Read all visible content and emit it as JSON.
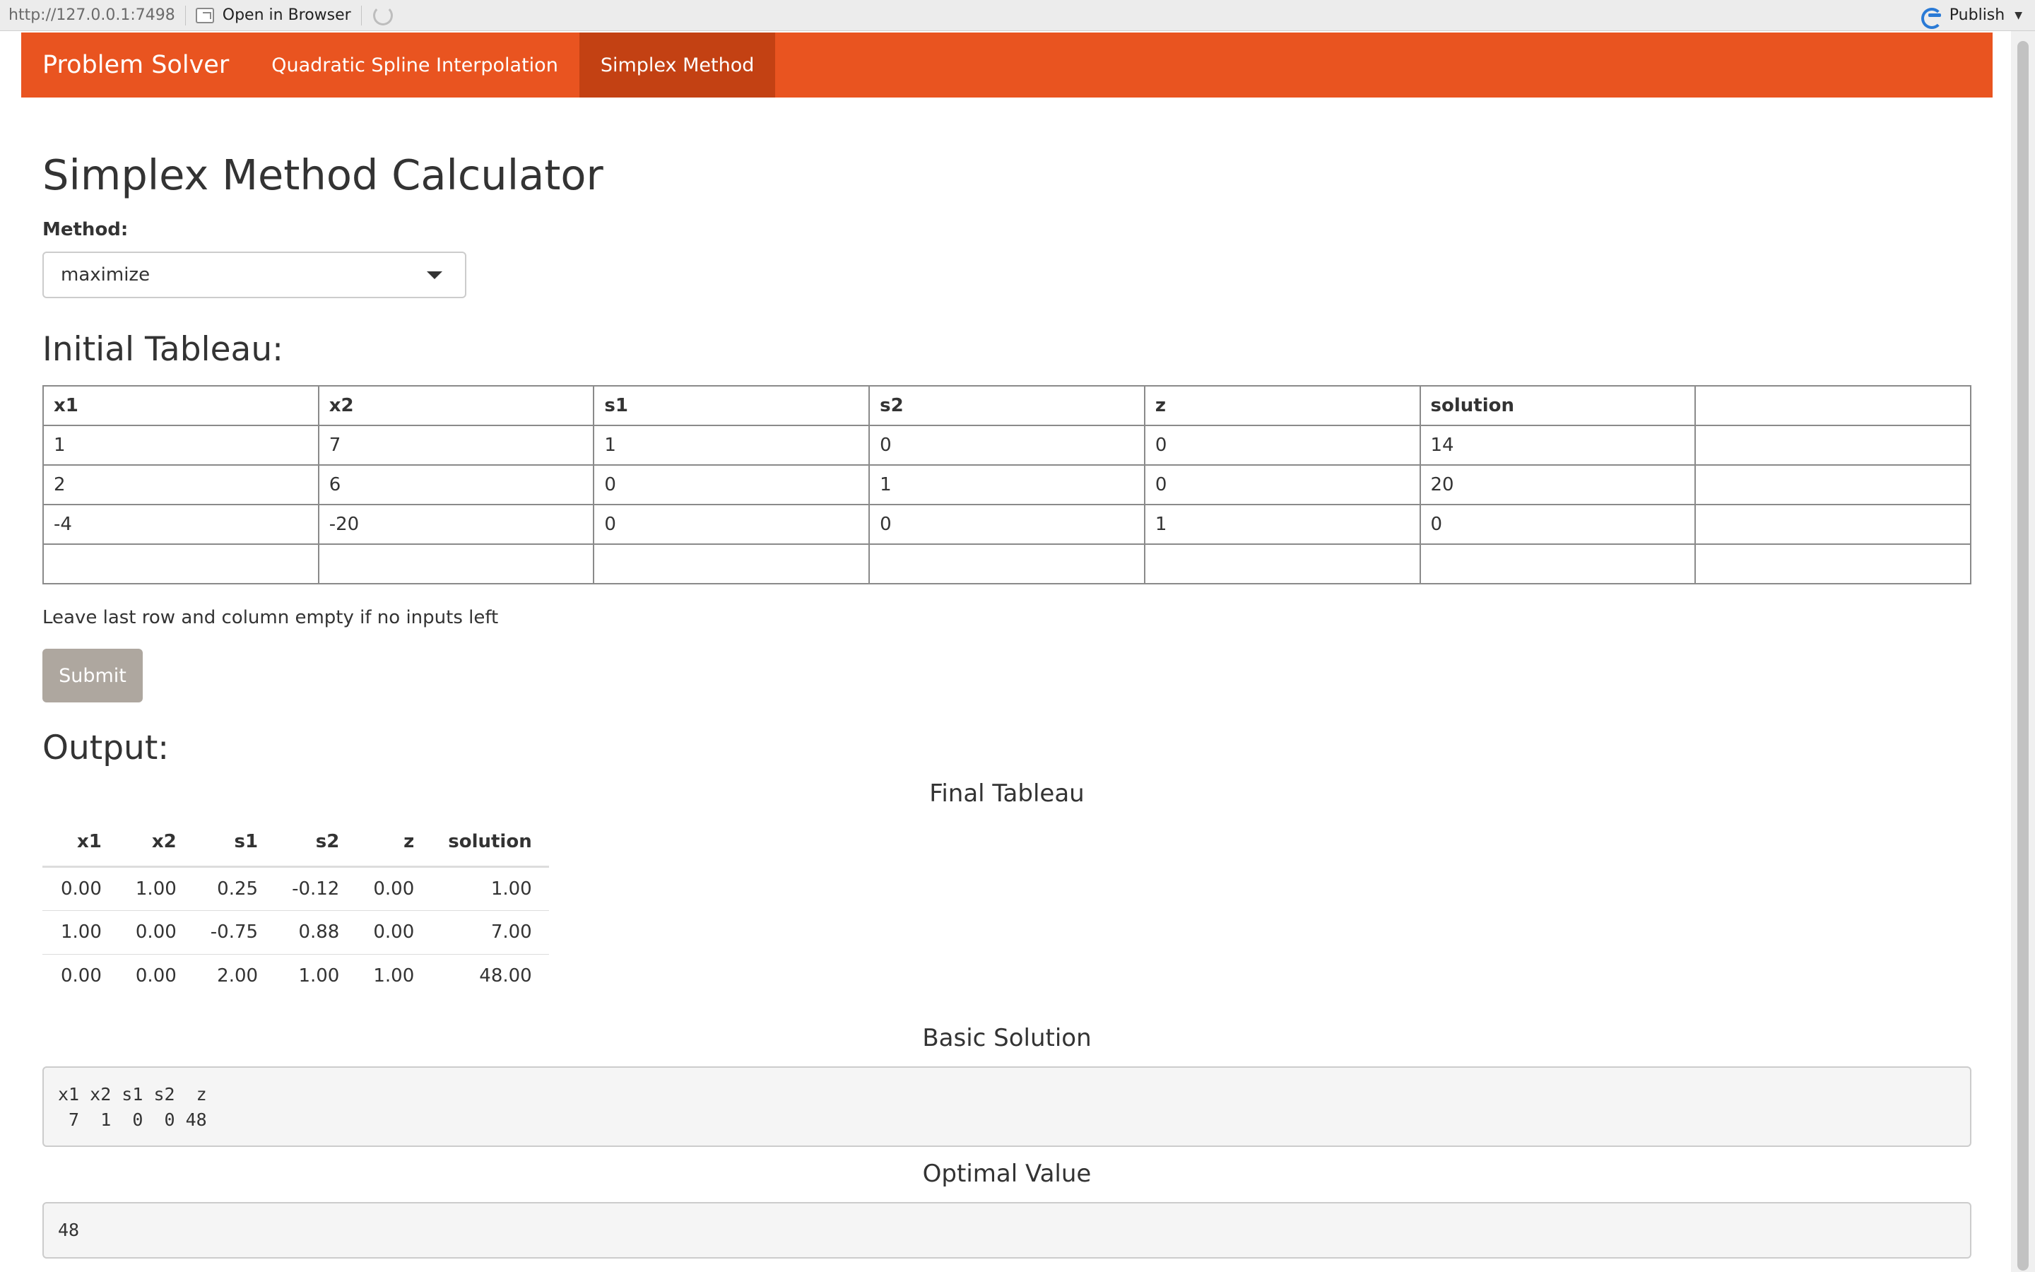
{
  "viewer": {
    "url": "http://127.0.0.1:7498",
    "open_in_browser": "Open in Browser",
    "publish": "Publish"
  },
  "navbar": {
    "brand": "Problem Solver",
    "tabs": [
      {
        "label": "Quadratic Spline Interpolation",
        "active": false
      },
      {
        "label": "Simplex Method",
        "active": true
      }
    ]
  },
  "colors": {
    "navbar": "#e95420",
    "active_tab": "#c34113",
    "button": "#aea79f"
  },
  "page": {
    "title": "Simplex Method Calculator",
    "method_label": "Method:",
    "method_value": "maximize",
    "initial_heading": "Initial Tableau:",
    "hint": "Leave last row and column empty if no inputs left",
    "submit": "Submit",
    "output_heading": "Output:"
  },
  "initial_tableau": {
    "headers": [
      "x1",
      "x2",
      "s1",
      "s2",
      "z",
      "solution",
      ""
    ],
    "rows": [
      [
        "1",
        "7",
        "1",
        "0",
        "0",
        "14",
        ""
      ],
      [
        "2",
        "6",
        "0",
        "1",
        "0",
        "20",
        ""
      ],
      [
        "-4",
        "-20",
        "0",
        "0",
        "1",
        "0",
        ""
      ],
      [
        "",
        "",
        "",
        "",
        "",
        "",
        ""
      ]
    ]
  },
  "final_tableau": {
    "title": "Final Tableau",
    "headers": [
      "x1",
      "x2",
      "s1",
      "s2",
      "z",
      "solution"
    ],
    "rows": [
      [
        "0.00",
        "1.00",
        "0.25",
        "-0.12",
        "0.00",
        "1.00"
      ],
      [
        "1.00",
        "0.00",
        "-0.75",
        "0.88",
        "0.00",
        "7.00"
      ],
      [
        "0.00",
        "0.00",
        "2.00",
        "1.00",
        "1.00",
        "48.00"
      ]
    ]
  },
  "basic_solution": {
    "title": "Basic Solution",
    "text": "x1 x2 s1 s2  z\n 7  1  0  0 48"
  },
  "optimal_value": {
    "title": "Optimal Value",
    "text": "48"
  }
}
